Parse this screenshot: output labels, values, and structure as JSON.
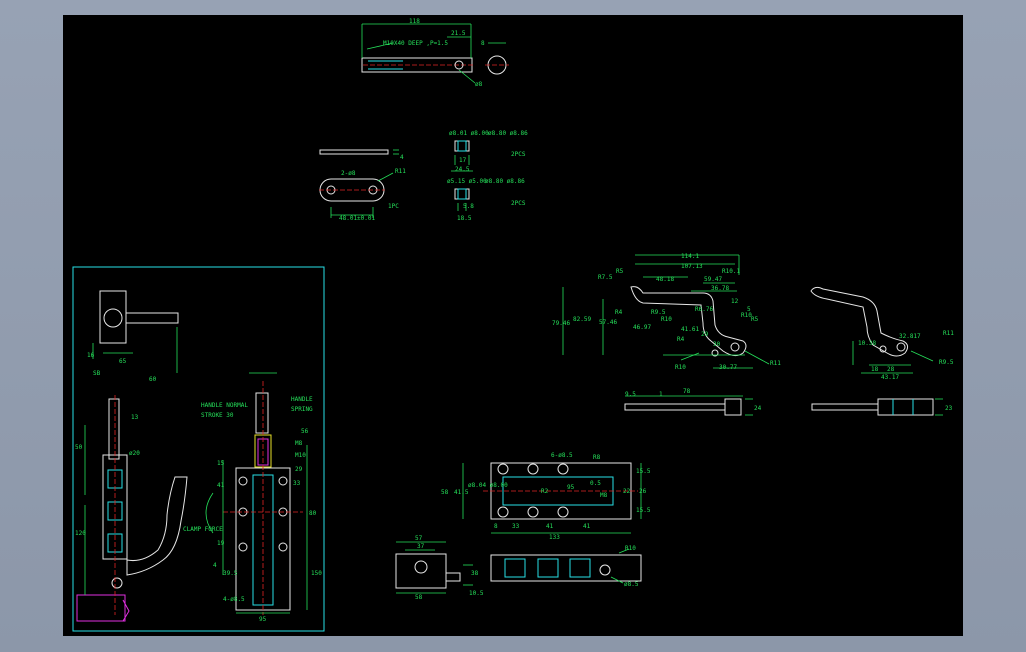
{
  "drawing": {
    "colors": {
      "background": "#000000",
      "frame": "#8c97a9",
      "outline": "#e6e6e6",
      "hidden": "#27e0e6",
      "dimension": "#25e05a",
      "centerline": "#e02424",
      "highlight": "#e030e0",
      "yellow": "#e8e02a"
    },
    "top_part": {
      "dims": {
        "overall": "118",
        "step": "21.5",
        "dia": "8",
        "thread": "M10X40 DEEP ,P=1.5",
        "hole": "ø8"
      }
    },
    "plate": {
      "thickness": "4",
      "slots": "2-ø8",
      "radius": "R11",
      "length": "48.01±0.01",
      "qty": "1PC"
    },
    "bushing1": {
      "d1": "ø8.01 ø8.00",
      "d2": "ø8.80 ø8.86",
      "len1": "17",
      "len2": "24.5",
      "qty": "2PCS"
    },
    "bushing2": {
      "d1": "ø5.15 ø5.00",
      "d2": "ø8.80 ø8.86",
      "len1": "5.8",
      "len2": "18.5",
      "qty": "2PCS"
    },
    "handle": {
      "dims": [
        "114.1",
        "107.13",
        "R7.5",
        "R5",
        "48.18",
        "59.47",
        "36.78",
        "R10.1",
        "79.46",
        "82.59",
        "57.46",
        "R4",
        "R9.5",
        "R10",
        "46.97",
        "41.61",
        "R4",
        "R6.76",
        "R10",
        "R5",
        "29",
        "30",
        "30.77",
        "12",
        "5",
        "R10",
        "R11"
      ]
    },
    "handle_small": {
      "dims": [
        "10.38",
        "18",
        "32.817",
        "28",
        "43.17",
        "R11",
        "R9.5"
      ]
    },
    "handle_side": {
      "dims": [
        "9.5",
        "1",
        "78",
        "24"
      ]
    },
    "handle_side_small": {
      "dims": [
        "23"
      ]
    },
    "base_top": {
      "holes": "6-ø8.5",
      "radius": "R8",
      "dims_right": [
        "15.5",
        "22",
        "26",
        "15.5"
      ],
      "dims_left": [
        "58",
        "41.5",
        "ø8.04 ø8.00"
      ],
      "inner": [
        "R2",
        "95",
        "0.5",
        "M8"
      ],
      "bottom": [
        "8",
        "33",
        "41",
        "41",
        "133"
      ]
    },
    "end_view": {
      "dims": [
        "57",
        "37",
        "38",
        "58",
        "10.5"
      ]
    },
    "base_front": {
      "dims": [
        "R10",
        "ø8.5"
      ]
    },
    "assembly": {
      "dims_top": [
        "65"
      ],
      "dims": [
        "16",
        "13",
        "ø20",
        "50",
        "120",
        "80",
        "4",
        "39.5",
        "15",
        "41",
        "19",
        "M8",
        "M10",
        "56",
        "29",
        "4-ø8.5",
        "33",
        "HANDLE",
        "SPRING",
        "150",
        "60",
        "SB",
        "95"
      ],
      "notes": [
        "HANDLE NORMAL",
        "STROKE 30"
      ],
      "clamp_force": "CLAMP FORCE"
    }
  }
}
